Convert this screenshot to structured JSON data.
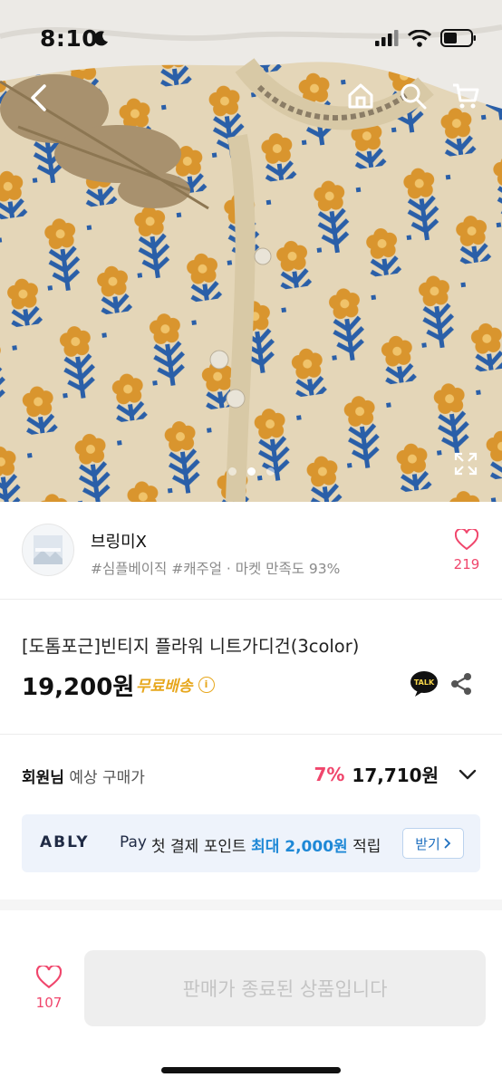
{
  "status_bar": {
    "time": "8:10"
  },
  "hero": {
    "current_slide": 2,
    "total_slides": 3
  },
  "seller": {
    "name": "브링미X",
    "tags": "#심플베이직 #캐주얼 · 마켓 만족도 93%",
    "like_count": "219"
  },
  "product": {
    "title": "[도톰포근]빈티지 플라워 니트가디건(3color)",
    "price": "19,200원",
    "free_shipping": "무료배송",
    "talk_label": "TALK"
  },
  "member_price": {
    "label_bold": "회원님",
    "label_rest": " 예상 구매가",
    "discount": "7%",
    "price": "17,710원"
  },
  "pay_banner": {
    "brand": "ABLY",
    "pay_word": "Pay",
    "text_pre": "첫 결제 포인트 ",
    "text_highlight": "최대 2,000원",
    "text_post": " 적립",
    "button_label": "받기"
  },
  "bottom_bar": {
    "like_count": "107",
    "sold_out_label": "판매가 종료된 상품입니다"
  },
  "colors": {
    "accent_pink": "#f0466c",
    "free_ship_yellow": "#e7a71d",
    "pay_blue": "#1e88d6"
  },
  "icons": [
    "back-icon",
    "home-icon",
    "search-icon",
    "cart-icon",
    "expand-icon",
    "heart-icon",
    "talk-icon",
    "share-icon",
    "info-icon",
    "chevron-down-icon",
    "chevron-right-icon"
  ]
}
